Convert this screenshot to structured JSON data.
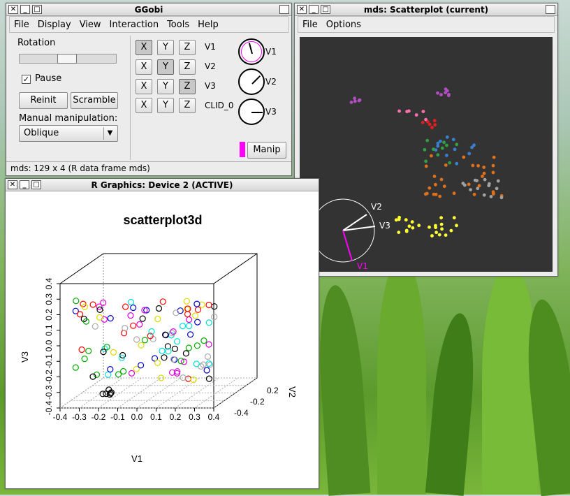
{
  "ggobi": {
    "title": "GGobi",
    "menu": [
      "File",
      "Display",
      "View",
      "Interaction",
      "Tools",
      "Help"
    ],
    "rotation_label": "Rotation",
    "pause_label": "Pause",
    "reinit_label": "Reinit",
    "scramble_label": "Scramble",
    "manual_label": "Manual manipulation:",
    "manual_value": "Oblique",
    "vars": [
      "V1",
      "V2",
      "V3",
      "CLID_0"
    ],
    "manip_label": "Manip",
    "status": "mds: 129 x 4 (R data frame mds)"
  },
  "scatter": {
    "title": "mds: Scatterplot (current)",
    "menu": [
      "File",
      "Options"
    ],
    "axis_labels": [
      "V2",
      "V3",
      "V1"
    ]
  },
  "rgraphics": {
    "title": "R Graphics: Device 2 (ACTIVE)",
    "plot_title": "scatterplot3d",
    "xlabel": "V1",
    "ylabel": "V3",
    "zlabel": "V2",
    "x_ticks": [
      "-0.4",
      "-0.3",
      "-0.2",
      "-0.1",
      "0.0",
      "0.1",
      "0.2",
      "0.3",
      "0.4"
    ],
    "y_ticks": [
      "-0.4",
      "-0.3",
      "-0.2",
      "-0.1",
      "0.0",
      "0.1",
      "0.2",
      "0.3",
      "0.4"
    ],
    "z_ticks": [
      "-0.4",
      "-0.2",
      "0.2"
    ]
  },
  "colors": {
    "plot_bg": "#333333",
    "magenta": "#ff00ff"
  }
}
